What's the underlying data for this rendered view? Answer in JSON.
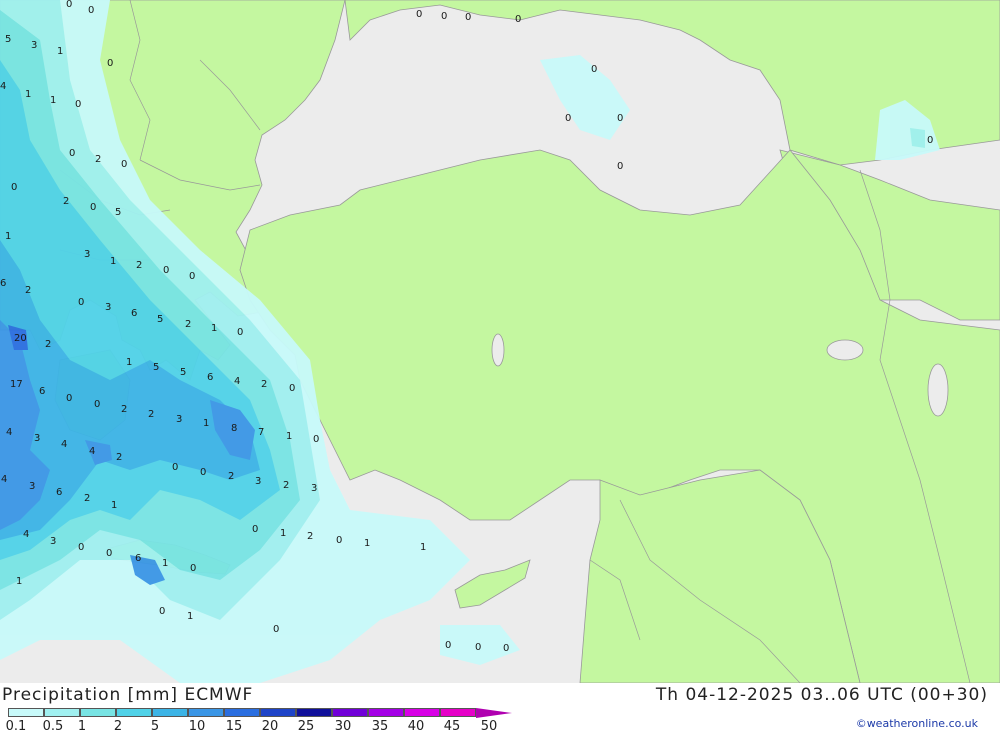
{
  "title": {
    "left": "Precipitation [mm] ECMWF",
    "right": "Th 04-12-2025 03..06 UTC (00+30)"
  },
  "credit": "©weatheronline.co.uk",
  "colors": {
    "sea": "#ececec",
    "land": "#c4f7a0",
    "border": "#999999"
  },
  "legend": {
    "labels": [
      "0.1",
      "0.5",
      "1",
      "2",
      "5",
      "10",
      "15",
      "20",
      "25",
      "30",
      "35",
      "40",
      "45",
      "50"
    ],
    "colors": [
      "#c8fafa",
      "#a0f0f0",
      "#78e4e4",
      "#50d2e8",
      "#3cb4e6",
      "#3a96e6",
      "#2a6ee0",
      "#1e44c8",
      "#10109a",
      "#7000d8",
      "#a400e6",
      "#d800e6",
      "#e600c8",
      "#b000b0"
    ]
  },
  "map_values": [
    "0",
    "0",
    "0",
    "0",
    "0",
    "0",
    "5",
    "3",
    "1",
    "0",
    "4",
    "1",
    "1",
    "0",
    "0",
    "0",
    "0",
    "0",
    "0",
    "0",
    "2",
    "0",
    "0",
    "2",
    "0",
    "5",
    "1",
    "3",
    "1",
    "2",
    "0",
    "0",
    "6",
    "2",
    "0",
    "3",
    "6",
    "5",
    "2",
    "1",
    "0",
    "20",
    "2",
    "1",
    "5",
    "5",
    "6",
    "4",
    "2",
    "0",
    "17",
    "6",
    "0",
    "0",
    "2",
    "2",
    "3",
    "1",
    "8",
    "7",
    "1",
    "0",
    "4",
    "3",
    "4",
    "4",
    "2",
    "0",
    "0",
    "2",
    "3",
    "2",
    "3",
    "4",
    "3",
    "6",
    "2",
    "1",
    "0",
    "1",
    "2",
    "0",
    "1",
    "1",
    "4",
    "3",
    "0",
    "0",
    "6",
    "1",
    "0",
    "1",
    "0",
    "1",
    "0",
    "0",
    "0",
    "0"
  ]
}
